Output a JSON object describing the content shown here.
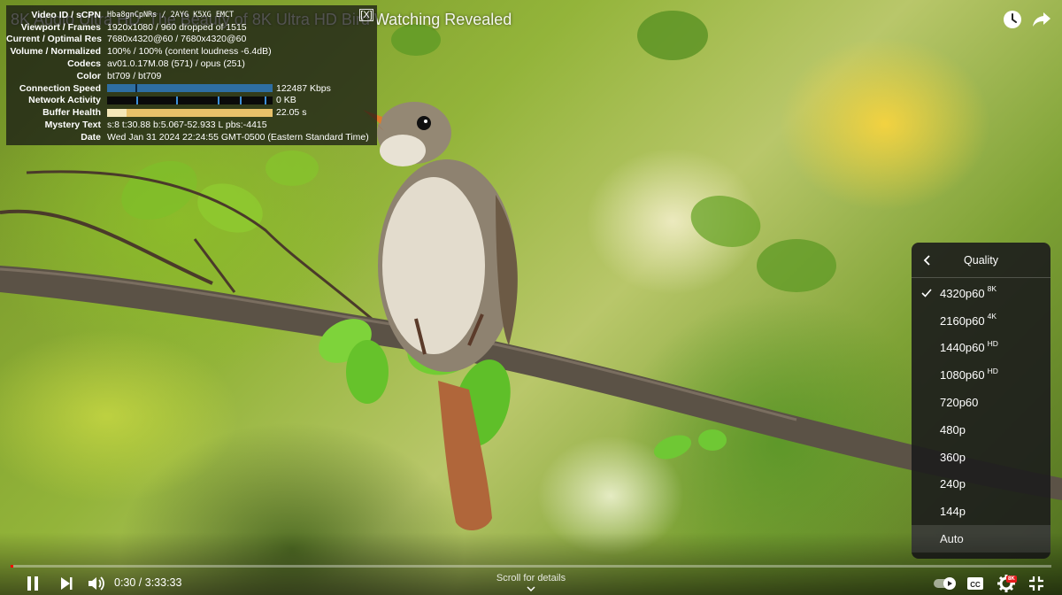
{
  "video": {
    "title": "8K Audio Ultra HD: The Beauty of 8K Ultra HD Bird Watching Revealed"
  },
  "stats": {
    "close_label": "[X]",
    "rows": [
      {
        "label": "Video ID / sCPN",
        "value": "Hba8gnCpNRs / 2AYG K5XG EMCT"
      },
      {
        "label": "Viewport / Frames",
        "value": "1920x1080 / 960 dropped of 1515"
      },
      {
        "label": "Current / Optimal Res",
        "value": "7680x4320@60 / 7680x4320@60"
      },
      {
        "label": "Volume / Normalized",
        "value": "100% / 100% (content loudness -6.4dB)"
      },
      {
        "label": "Codecs",
        "value": "av01.0.17M.08 (571) / opus (251)"
      },
      {
        "label": "Color",
        "value": "bt709 / bt709"
      },
      {
        "label": "Connection Speed",
        "value": "122487 Kbps"
      },
      {
        "label": "Network Activity",
        "value": "0 KB"
      },
      {
        "label": "Buffer Health",
        "value": "22.05 s"
      },
      {
        "label": "Mystery Text",
        "value": "s:8 t:30.88 b:5.067-52.933 L pbs:-4415"
      },
      {
        "label": "Date",
        "value": "Wed Jan 31 2024 22:24:55 GMT-0500 (Eastern Standard Time)"
      }
    ],
    "buffer_fill_fraction": 0.12
  },
  "quality_menu": {
    "title": "Quality",
    "options": [
      {
        "label": "4320p60",
        "badge": "8K",
        "selected": true
      },
      {
        "label": "2160p60",
        "badge": "4K",
        "selected": false
      },
      {
        "label": "1440p60",
        "badge": "HD",
        "selected": false
      },
      {
        "label": "1080p60",
        "badge": "HD",
        "selected": false
      },
      {
        "label": "720p60",
        "badge": "",
        "selected": false
      },
      {
        "label": "480p",
        "badge": "",
        "selected": false
      },
      {
        "label": "360p",
        "badge": "",
        "selected": false
      },
      {
        "label": "240p",
        "badge": "",
        "selected": false
      },
      {
        "label": "144p",
        "badge": "",
        "selected": false
      },
      {
        "label": "Auto",
        "badge": "",
        "selected": false,
        "hover": true
      }
    ]
  },
  "controls": {
    "time_display": "0:30 / 3:33:33",
    "progress_fraction": 0.0023,
    "scroll_hint": "Scroll for details",
    "settings_badge": "8K"
  },
  "icons": {
    "watch_later": "clock-icon",
    "share": "share-arrow-icon",
    "pause": "pause-icon",
    "next": "next-icon",
    "volume": "volume-icon",
    "autoplay": "autoplay-toggle-icon",
    "captions": "cc-icon",
    "settings": "gear-icon",
    "fullscreen": "exit-fullscreen-icon"
  },
  "colors": {
    "progress_played": "#ff0000",
    "settings_badge": "#e51d1d",
    "speed_bar": "#2e6ea3",
    "buffer_bar": "#e8c16a"
  }
}
